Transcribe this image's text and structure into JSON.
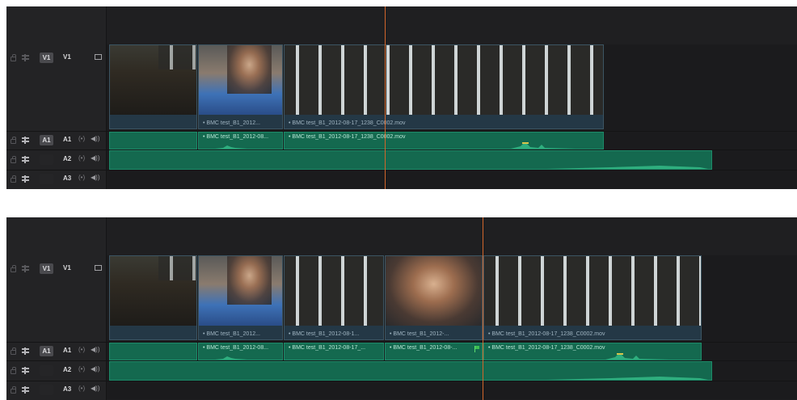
{
  "tracks": {
    "v1": {
      "badge": "V1",
      "name": "V1"
    },
    "a1": {
      "badge": "A1",
      "name": "A1",
      "solo": "(•)",
      "mute": "◀))"
    },
    "a2": {
      "name": "A2",
      "solo": "(•)",
      "mute": "◀))"
    },
    "a3": {
      "name": "A3",
      "solo": "(•)",
      "mute": "◀))"
    }
  },
  "panel1": {
    "video_clips": [
      {
        "label": ""
      },
      {
        "label": "• BMC test_B1_2012..."
      },
      {
        "label": "• BMC test_B1_2012-08-17_1238_C0002.mov"
      }
    ],
    "audio_clips": [
      {
        "label": "• BMC test_B1_2012-08..."
      },
      {
        "label": "• BMC test_B1_2012-08-17_1238_C0002.mov"
      }
    ]
  },
  "panel2": {
    "video_clips": [
      {
        "label": ""
      },
      {
        "label": "• BMC test_B1_2012..."
      },
      {
        "label": "• BMC test_B1_2012-08-1..."
      },
      {
        "label": "• BMC test_B1_2012-..."
      },
      {
        "label": "• BMC test_B1_2012-08-17_1238_C0002.mov"
      }
    ],
    "audio_clips": [
      {
        "label": "• BMC test_B1_2012-08..."
      },
      {
        "label": "• BMC test_B1_2012-08-17_..."
      },
      {
        "label": "• BMC test_B1_2012-08-..."
      },
      {
        "label": "• BMC test_B1_2012-08-17_1238_C0002.mov"
      }
    ]
  },
  "colors": {
    "playhead": "#d1662b",
    "audio_clip": "#14694f",
    "video_clip_border": "#3c5563"
  }
}
